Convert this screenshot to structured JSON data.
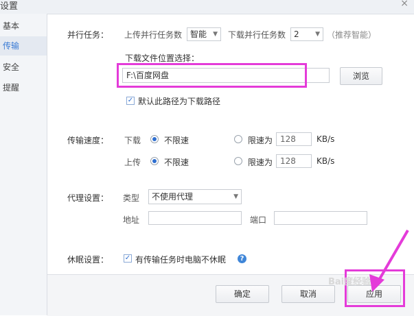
{
  "window": {
    "title": "设置",
    "close_glyph": "×"
  },
  "sidebar": {
    "items": [
      {
        "label": "基本",
        "active": false
      },
      {
        "label": "传输",
        "active": true
      },
      {
        "label": "安全",
        "active": false
      },
      {
        "label": "提醒",
        "active": false
      }
    ]
  },
  "parallel": {
    "label": "并行任务：",
    "upload_label": "上传并行任务数",
    "upload_value": "智能",
    "download_label": "下载并行任务数",
    "download_value": "2",
    "hint": "（推荐智能）"
  },
  "download_location": {
    "label": "下载文件位置选择：",
    "path": "F:\\百度网盘",
    "browse_label": "浏览",
    "default_checkbox_label": "默认此路径为下载路径",
    "default_checked": true
  },
  "speed": {
    "label": "传输速度：",
    "download_label": "下载",
    "upload_label": "上传",
    "unlimited_label": "不限速",
    "limit_label": "限速为",
    "download_limit_value": "128",
    "upload_limit_value": "128",
    "unit": "KB/s",
    "download_mode": "unlimited",
    "upload_mode": "unlimited"
  },
  "proxy": {
    "label": "代理设置：",
    "type_label": "类型",
    "type_value": "不使用代理",
    "address_label": "地址",
    "address_value": "",
    "port_label": "端口",
    "port_value": ""
  },
  "sleep": {
    "label": "休眠设置：",
    "checkbox_label": "有传输任务时电脑不休眠",
    "checked": true
  },
  "footer": {
    "ok_label": "确定",
    "cancel_label": "取消",
    "apply_label": "应用"
  },
  "watermark": "Bai度经验",
  "colors": {
    "highlight": "#e43bd9",
    "accent": "#2f6fd0"
  }
}
